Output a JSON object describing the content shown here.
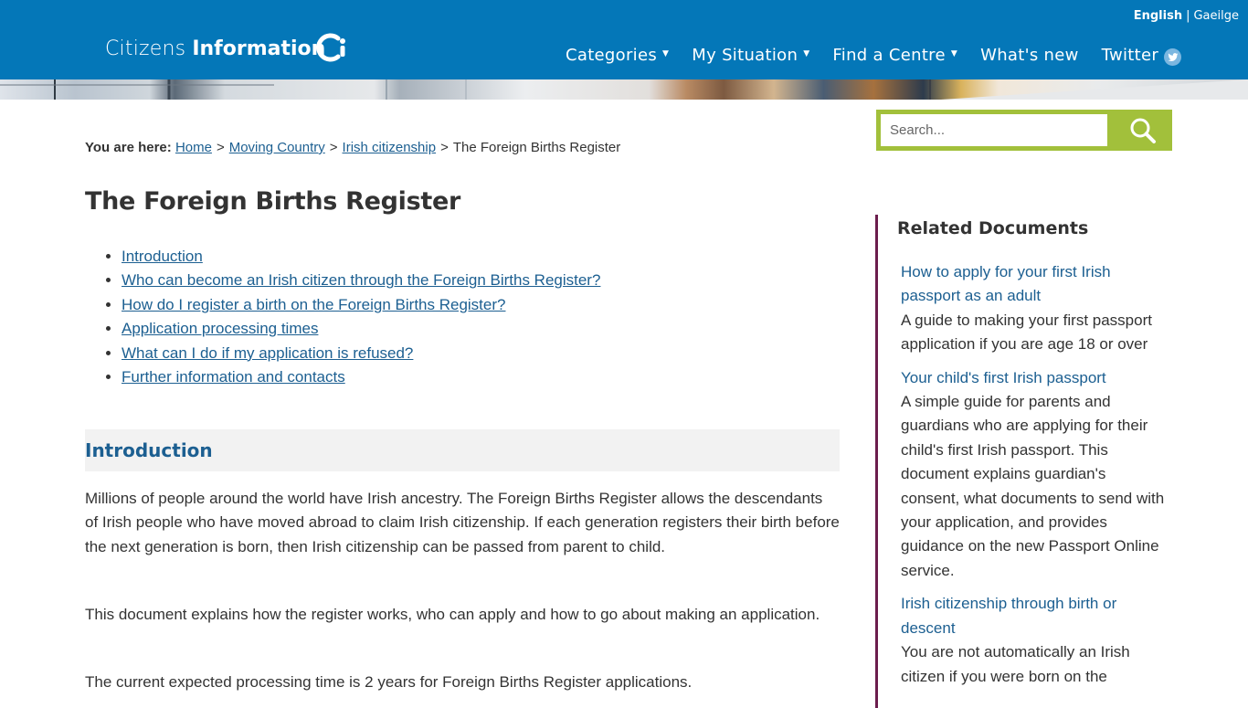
{
  "header": {
    "logo_light": "Citizens",
    "logo_bold": "Information",
    "languages": [
      "English",
      "Gaeilge"
    ],
    "nav": [
      {
        "label": "Categories",
        "has_dropdown": true
      },
      {
        "label": "My Situation",
        "has_dropdown": true
      },
      {
        "label": "Find a Centre",
        "has_dropdown": true
      },
      {
        "label": "What's new",
        "has_dropdown": false
      },
      {
        "label": "Twitter",
        "has_dropdown": false,
        "icon": "twitter-bird-icon"
      }
    ]
  },
  "breadcrumb": {
    "label": "You are here:",
    "links": [
      "Home",
      "Moving Country",
      "Irish citizenship"
    ],
    "current": "The Foreign Births Register"
  },
  "search": {
    "placeholder": "Search...",
    "icon": "magnifier-icon"
  },
  "main": {
    "title": "The Foreign Births Register",
    "toc": [
      "Introduction",
      "Who can become an Irish citizen through the Foreign Births Register?",
      "How do I register a birth on the Foreign Births Register?",
      "Application processing times",
      "What can I do if my application is refused?",
      "Further information and contacts"
    ],
    "section_heading": "Introduction",
    "paragraphs": [
      "Millions of people around the world have Irish ancestry. The Foreign Births Register allows the descendants of Irish people who have moved abroad to claim Irish citizenship. If each generation registers their birth before the next generation is born, then Irish citizenship can be passed from parent to child.",
      "This document explains how the register works, who can apply and how to go about making an application.",
      "The current expected processing time is 2 years for Foreign Births Register applications."
    ]
  },
  "sidebar": {
    "title": "Related Documents",
    "items": [
      {
        "link": "How to apply for your first Irish passport as an adult",
        "desc": "A guide to making your first passport application if you are age 18 or over"
      },
      {
        "link": "Your child's first Irish passport",
        "desc": "A simple guide for parents and guardians who are applying for their child's first Irish passport. This document explains guardian's consent, what documents to send with your application, and provides guidance on the new Passport Online service."
      },
      {
        "link": "Irish citizenship through birth or descent",
        "desc": "You are not automatically an Irish citizen if you were born on the"
      }
    ]
  },
  "colors": {
    "header_bg": "#0477b8",
    "link": "#1c5f91",
    "search_accent": "#a2c03b",
    "sidebar_border": "#6b1d4d",
    "section_bg": "#f2f2f2"
  }
}
